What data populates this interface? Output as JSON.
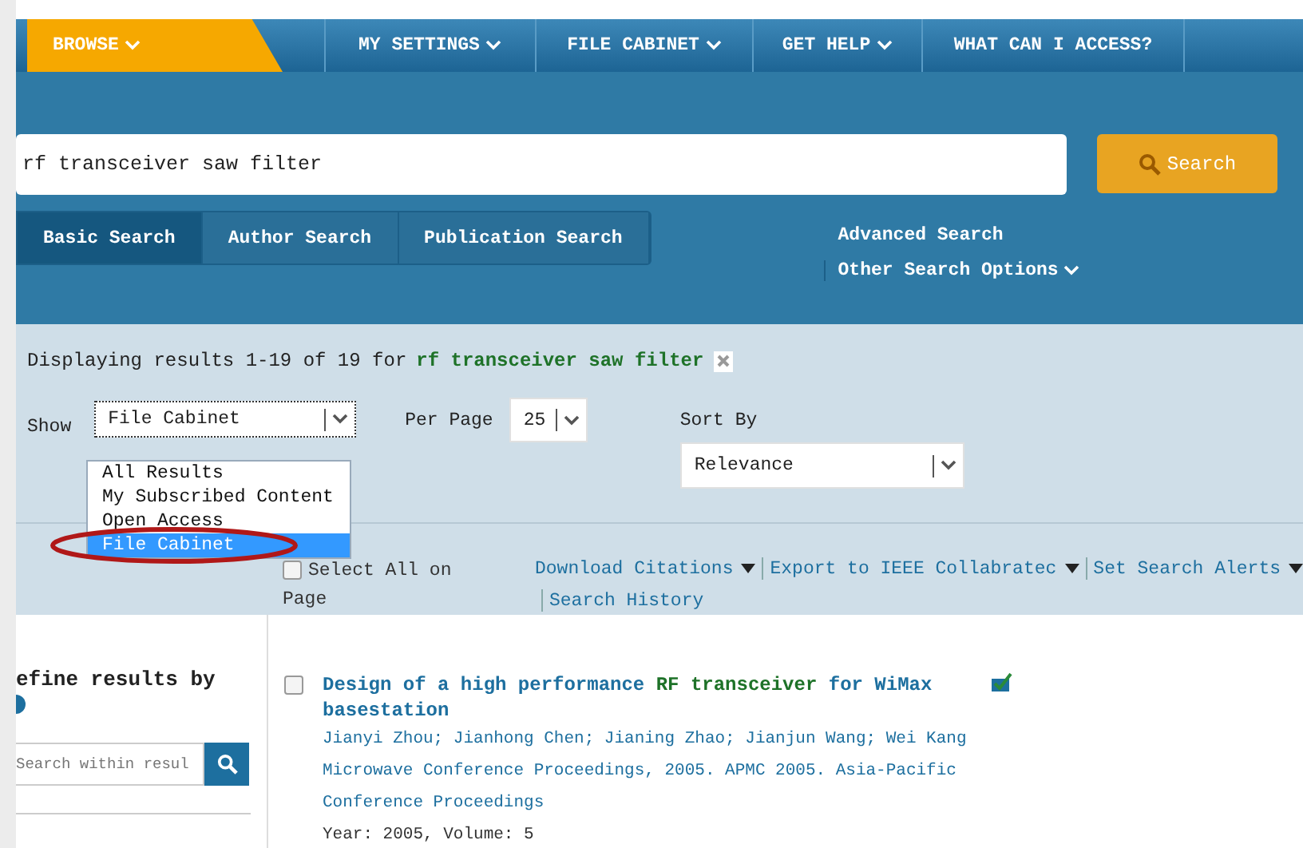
{
  "nav": [
    {
      "label": "BROWSE",
      "selected": true,
      "caret": true
    },
    {
      "label": "MY SETTINGS",
      "selected": false,
      "caret": true
    },
    {
      "label": "FILE CABINET",
      "selected": false,
      "caret": true
    },
    {
      "label": "GET HELP",
      "selected": false,
      "caret": true
    },
    {
      "label": "WHAT CAN I ACCESS?",
      "selected": false,
      "caret": false
    }
  ],
  "search": {
    "value": "rf transceiver saw filter",
    "button": "Search"
  },
  "search_tabs": [
    {
      "label": "Basic Search",
      "selected": true
    },
    {
      "label": "Author Search",
      "selected": false
    },
    {
      "label": "Publication Search",
      "selected": false
    }
  ],
  "links": {
    "advanced": "Advanced Search",
    "other": "Other Search Options"
  },
  "summary": {
    "text": "Displaying results 1-19 of 19 for",
    "query": "rf transceiver saw filter"
  },
  "filters": {
    "show_label": "Show",
    "show_value": "File Cabinet",
    "per_page_label": "Per Page",
    "per_page_value": "25",
    "sort_label": "Sort By",
    "sort_value": "Relevance"
  },
  "show_options": [
    {
      "label": "All Results",
      "selected": false
    },
    {
      "label": "My Subscribed Content",
      "selected": false
    },
    {
      "label": "Open Access",
      "selected": false
    },
    {
      "label": "File Cabinet",
      "selected": true
    }
  ],
  "actions": {
    "select_all": "Select All on Page",
    "select_all_checked": false,
    "download": "Download Citations",
    "export": "Export to IEEE Collabratec",
    "alerts": "Set Search Alerts",
    "history": "Search History"
  },
  "refine": {
    "title": "efine results by",
    "placeholder": "Search within resul"
  },
  "results": [
    {
      "checked": false,
      "title_parts": [
        {
          "text": "Design of a high performance ",
          "highlight": false
        },
        {
          "text": "RF transceiver",
          "highlight": true
        },
        {
          "text": " for WiMax basestation",
          "highlight": false
        }
      ],
      "authors": "Jianyi Zhou; Jianhong Chen; Jianing Zhao; Jianjun Wang; Wei Kang",
      "venue": "Microwave Conference Proceedings, 2005. APMC 2005. Asia-Pacific Conference Proceedings",
      "meta": "Year: 2005, Volume: 5"
    }
  ]
}
